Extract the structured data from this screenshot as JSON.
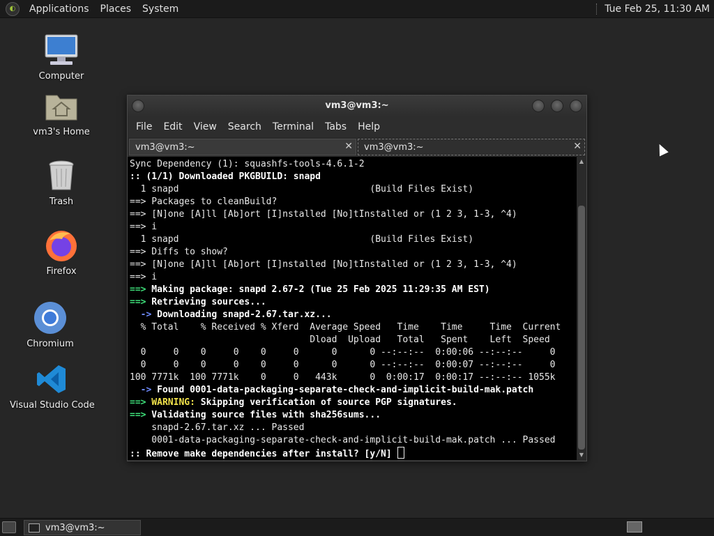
{
  "top_panel": {
    "menus": [
      "Applications",
      "Places",
      "System"
    ],
    "clock": "Tue Feb 25, 11:30 AM"
  },
  "desktop_icons": [
    {
      "label": "Computer",
      "icon": "computer-icon"
    },
    {
      "label": "vm3's Home",
      "icon": "home-folder-icon"
    },
    {
      "label": "Trash",
      "icon": "trash-icon"
    },
    {
      "label": "Firefox",
      "icon": "firefox-icon"
    },
    {
      "label": "Chromium",
      "icon": "chromium-icon"
    },
    {
      "label": "Visual Studio Code",
      "icon": "vscode-icon"
    }
  ],
  "window": {
    "title": "vm3@vm3:~",
    "menus": [
      "File",
      "Edit",
      "View",
      "Search",
      "Terminal",
      "Tabs",
      "Help"
    ],
    "tabs": [
      {
        "label": "vm3@vm3:~"
      },
      {
        "label": "vm3@vm3:~"
      }
    ],
    "close_glyph": "✕"
  },
  "terminal": {
    "lines": [
      [
        "Sync Dependency (1): squashfs-tools-4.6.1-2"
      ],
      [
        ":: (1/1) Downloaded PKGBUILD: snapd"
      ],
      [
        "  1 snapd                                   (Build Files Exist)"
      ],
      [
        "==> Packages to cleanBuild?"
      ],
      [
        "==> [N]one [A]ll [Ab]ort [I]nstalled [No]tInstalled or (1 2 3, 1-3, ^4)"
      ],
      [
        "==> i"
      ],
      [
        "  1 snapd                                   (Build Files Exist)"
      ],
      [
        "==> Diffs to show?"
      ],
      [
        "==> [N]one [A]ll [Ab]ort [I]nstalled [No]tInstalled or (1 2 3, 1-3, ^4)"
      ],
      [
        "==> i"
      ],
      [
        "==>",
        " Making package: snapd 2.67-2 (Tue 25 Feb 2025 11:29:35 AM EST)"
      ],
      [
        "==>",
        " Retrieving sources..."
      ],
      [
        "  ->",
        " Downloading snapd-2.67.tar.xz..."
      ],
      [
        "  % Total    % Received % Xferd  Average Speed   Time    Time     Time  Current"
      ],
      [
        "                                 Dload  Upload   Total   Spent    Left  Speed"
      ],
      [
        "  0     0    0     0    0     0      0      0 --:--:--  0:00:06 --:--:--     0"
      ],
      [
        "  0     0    0     0    0     0      0      0 --:--:--  0:00:07 --:--:--     0"
      ],
      [
        "100 7771k  100 7771k    0     0   443k      0  0:00:17  0:00:17 --:--:-- 1055k"
      ],
      [
        "  ->",
        " Found 0001-data-packaging-separate-check-and-implicit-build-mak.patch"
      ],
      [
        "==>",
        " WARNING:",
        " Skipping verification of source PGP signatures."
      ],
      [
        "==>",
        " Validating source files with sha256sums..."
      ],
      [
        "    snapd-2.67.tar.xz ... Passed"
      ],
      [
        "    0001-data-packaging-separate-check-and-implicit-build-mak.patch ... Passed"
      ],
      [
        ":: Remove make dependencies after install? [y/N] "
      ]
    ]
  },
  "taskbar": {
    "task_label": "vm3@vm3:~"
  },
  "colors": {
    "green": "#3ee07a",
    "yellow": "#f1e24a",
    "blue": "#6f8bff",
    "terminal_bg": "#000000",
    "desktop_bg": "#262626"
  }
}
